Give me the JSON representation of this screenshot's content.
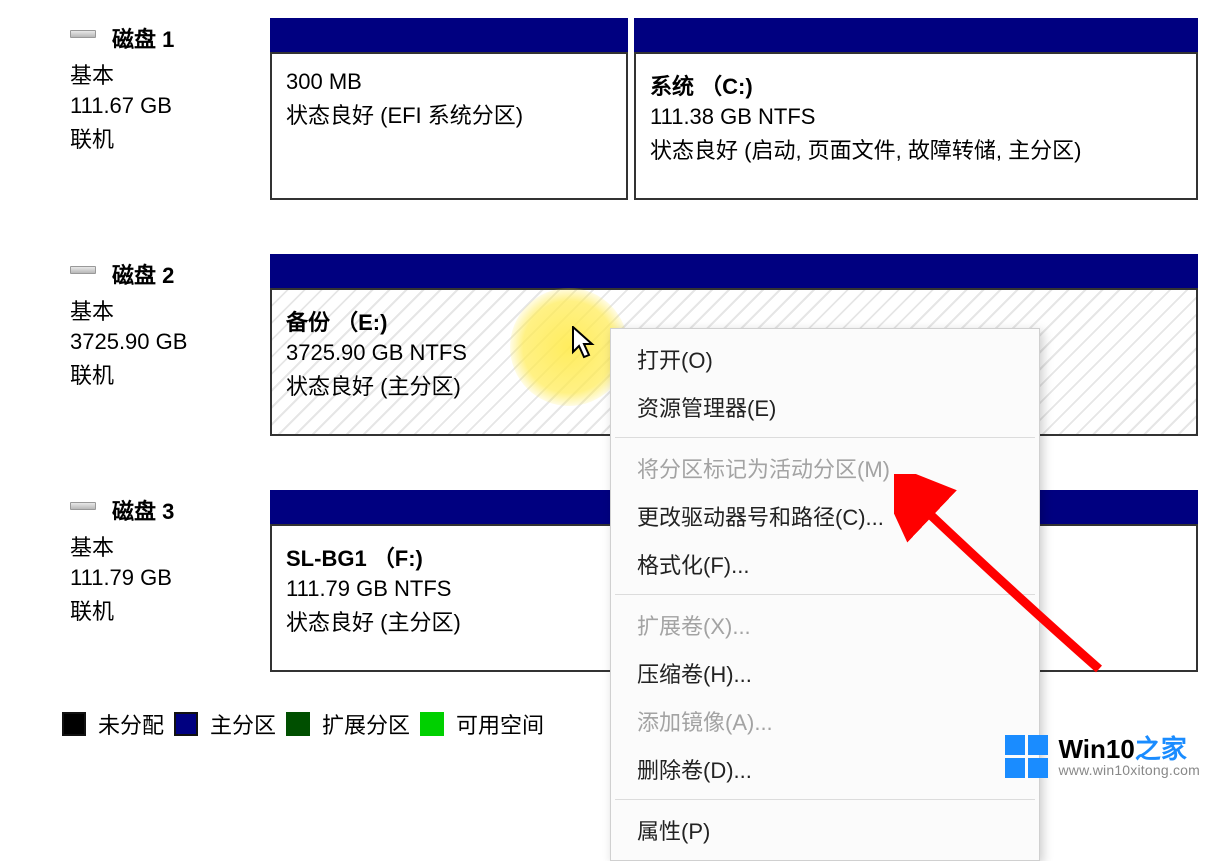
{
  "disks": {
    "d1": {
      "name": "磁盘 1",
      "type": "基本",
      "size": "111.67 GB",
      "status": "联机",
      "parts": {
        "efi": {
          "size": "300 MB",
          "status": "状态良好 (EFI 系统分区)"
        },
        "c": {
          "title": "系统 （C:)",
          "size": "111.38 GB NTFS",
          "status": "状态良好 (启动, 页面文件, 故障转储, 主分区)"
        }
      }
    },
    "d2": {
      "name": "磁盘 2",
      "type": "基本",
      "size": "3725.90 GB",
      "status": "联机",
      "parts": {
        "e": {
          "title": "备份 （E:)",
          "size": "3725.90 GB NTFS",
          "status": "状态良好 (主分区)"
        }
      }
    },
    "d3": {
      "name": "磁盘 3",
      "type": "基本",
      "size": "111.79 GB",
      "status": "联机",
      "parts": {
        "f": {
          "title": "SL-BG1 （F:)",
          "size": "111.79 GB NTFS",
          "status": "状态良好 (主分区)"
        }
      }
    }
  },
  "legend": {
    "unalloc": "未分配",
    "primary": "主分区",
    "extended": "扩展分区",
    "free": "可用空间"
  },
  "menu": {
    "open": "打开(O)",
    "explorer": "资源管理器(E)",
    "markActive": "将分区标记为活动分区(M)",
    "changeDrive": "更改驱动器号和路径(C)...",
    "format": "格式化(F)...",
    "extend": "扩展卷(X)...",
    "shrink": "压缩卷(H)...",
    "mirror": "添加镜像(A)...",
    "delete": "删除卷(D)...",
    "properties": "属性(P)"
  },
  "brand": {
    "title_a": "Win10",
    "title_b": "之家",
    "url": "www.win10xitong.com"
  },
  "colors": {
    "navy": "#000080"
  }
}
